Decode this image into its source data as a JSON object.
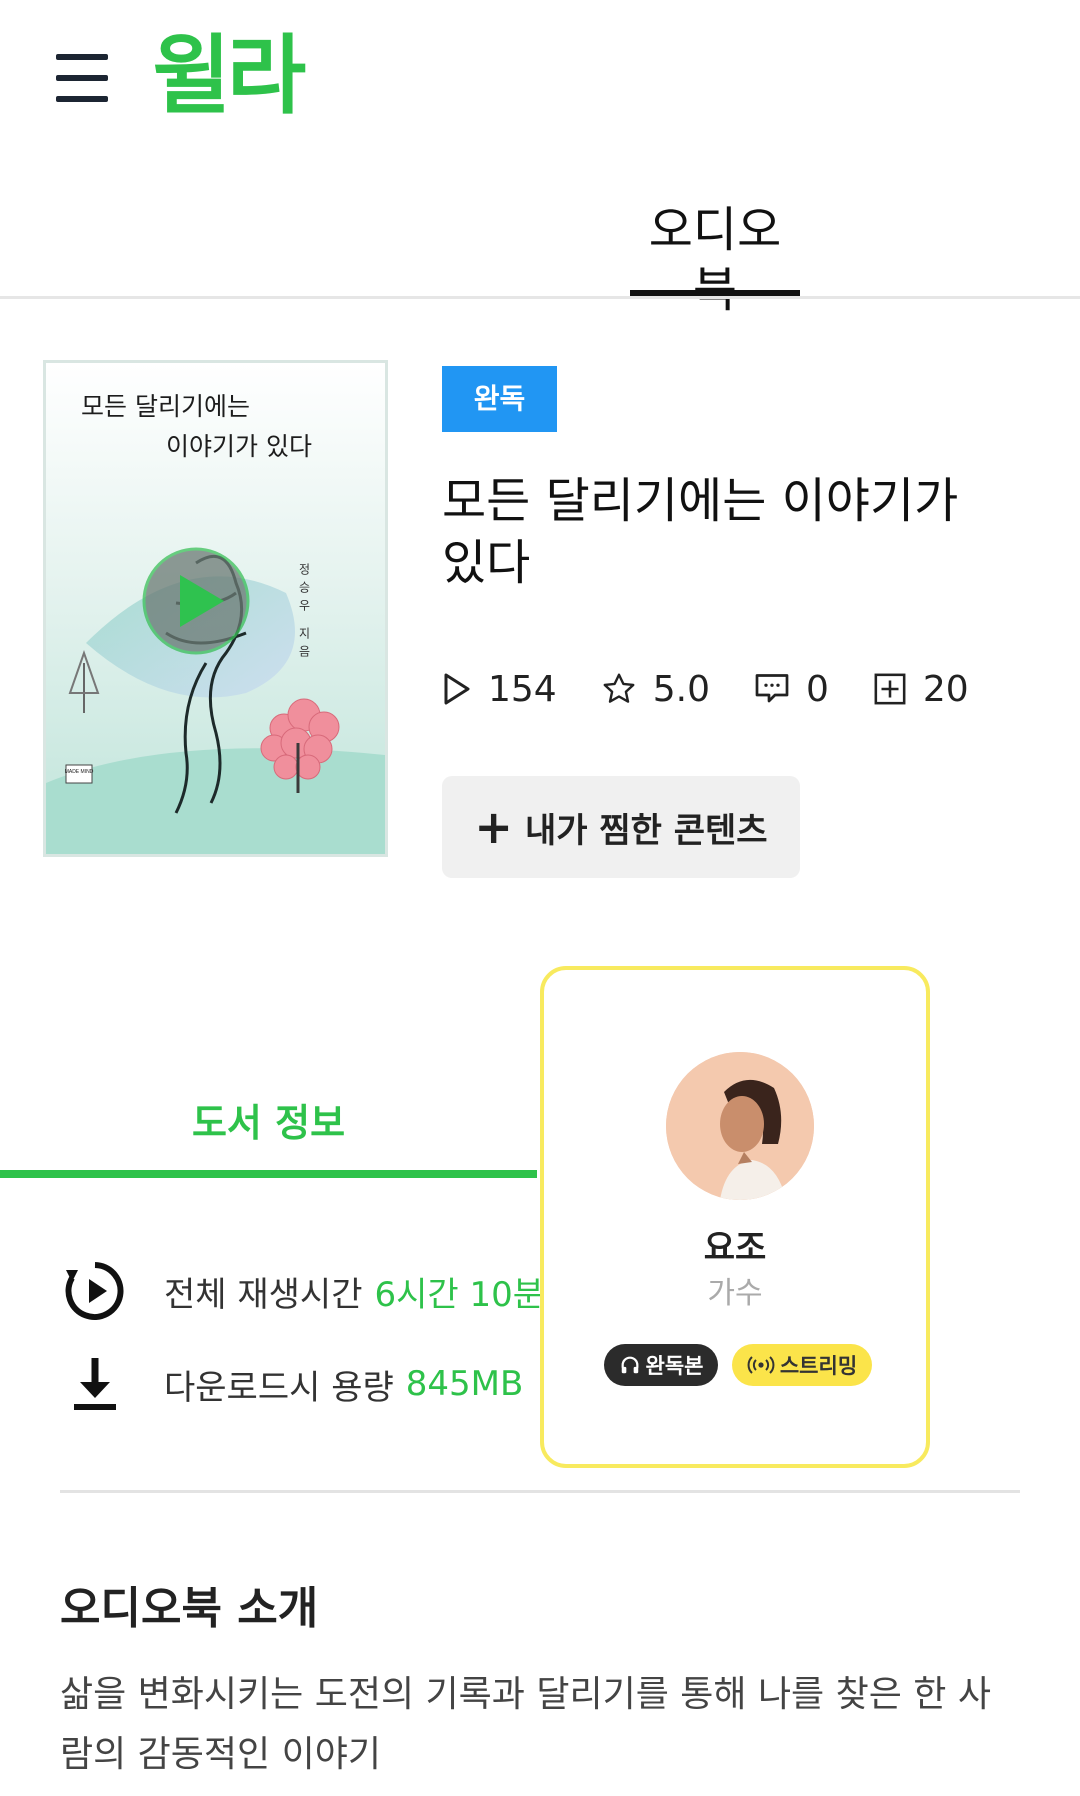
{
  "header": {
    "logo": "윌라"
  },
  "tabs": {
    "active": "오디오북"
  },
  "book": {
    "cover": {
      "title_line1": "모든 달리기에는",
      "title_line2": "이야기가 있다",
      "author_vertical": "정승우 지음",
      "publisher_mark": "MADE MIND"
    },
    "badge": "완독",
    "title": "모든 달리기에는 이야기가 있다",
    "stats": {
      "plays": "154",
      "rating": "5.0",
      "comments": "0",
      "adds": "20"
    },
    "favorite_button": "내가 찜한 콘텐츠"
  },
  "info_tab": {
    "label": "도서 정보"
  },
  "info": {
    "duration_label": "전체 재생시간",
    "duration_value": "6시간 10분",
    "size_label": "다운로드시 용량",
    "size_value": "845MB"
  },
  "narrator": {
    "name": "요조",
    "role": "가수",
    "chip_full": "완독본",
    "chip_stream": "스트리밍"
  },
  "intro": {
    "title": "오디오북 소개",
    "text": "삶을 변화시키는 도전의 기록과 달리기를 통해 나를 찾은 한 사람의 감동적인 이야기"
  },
  "colors": {
    "brand_green": "#2ec24a",
    "badge_blue": "#2196f3",
    "card_border_yellow": "#f8ea5e",
    "chip_yellow": "#fbe44a"
  },
  "icons": [
    "menu-icon",
    "play-count-icon",
    "star-icon",
    "comment-icon",
    "add-box-icon",
    "plus-icon",
    "replay-play-icon",
    "download-icon",
    "headphones-icon",
    "broadcast-icon"
  ]
}
